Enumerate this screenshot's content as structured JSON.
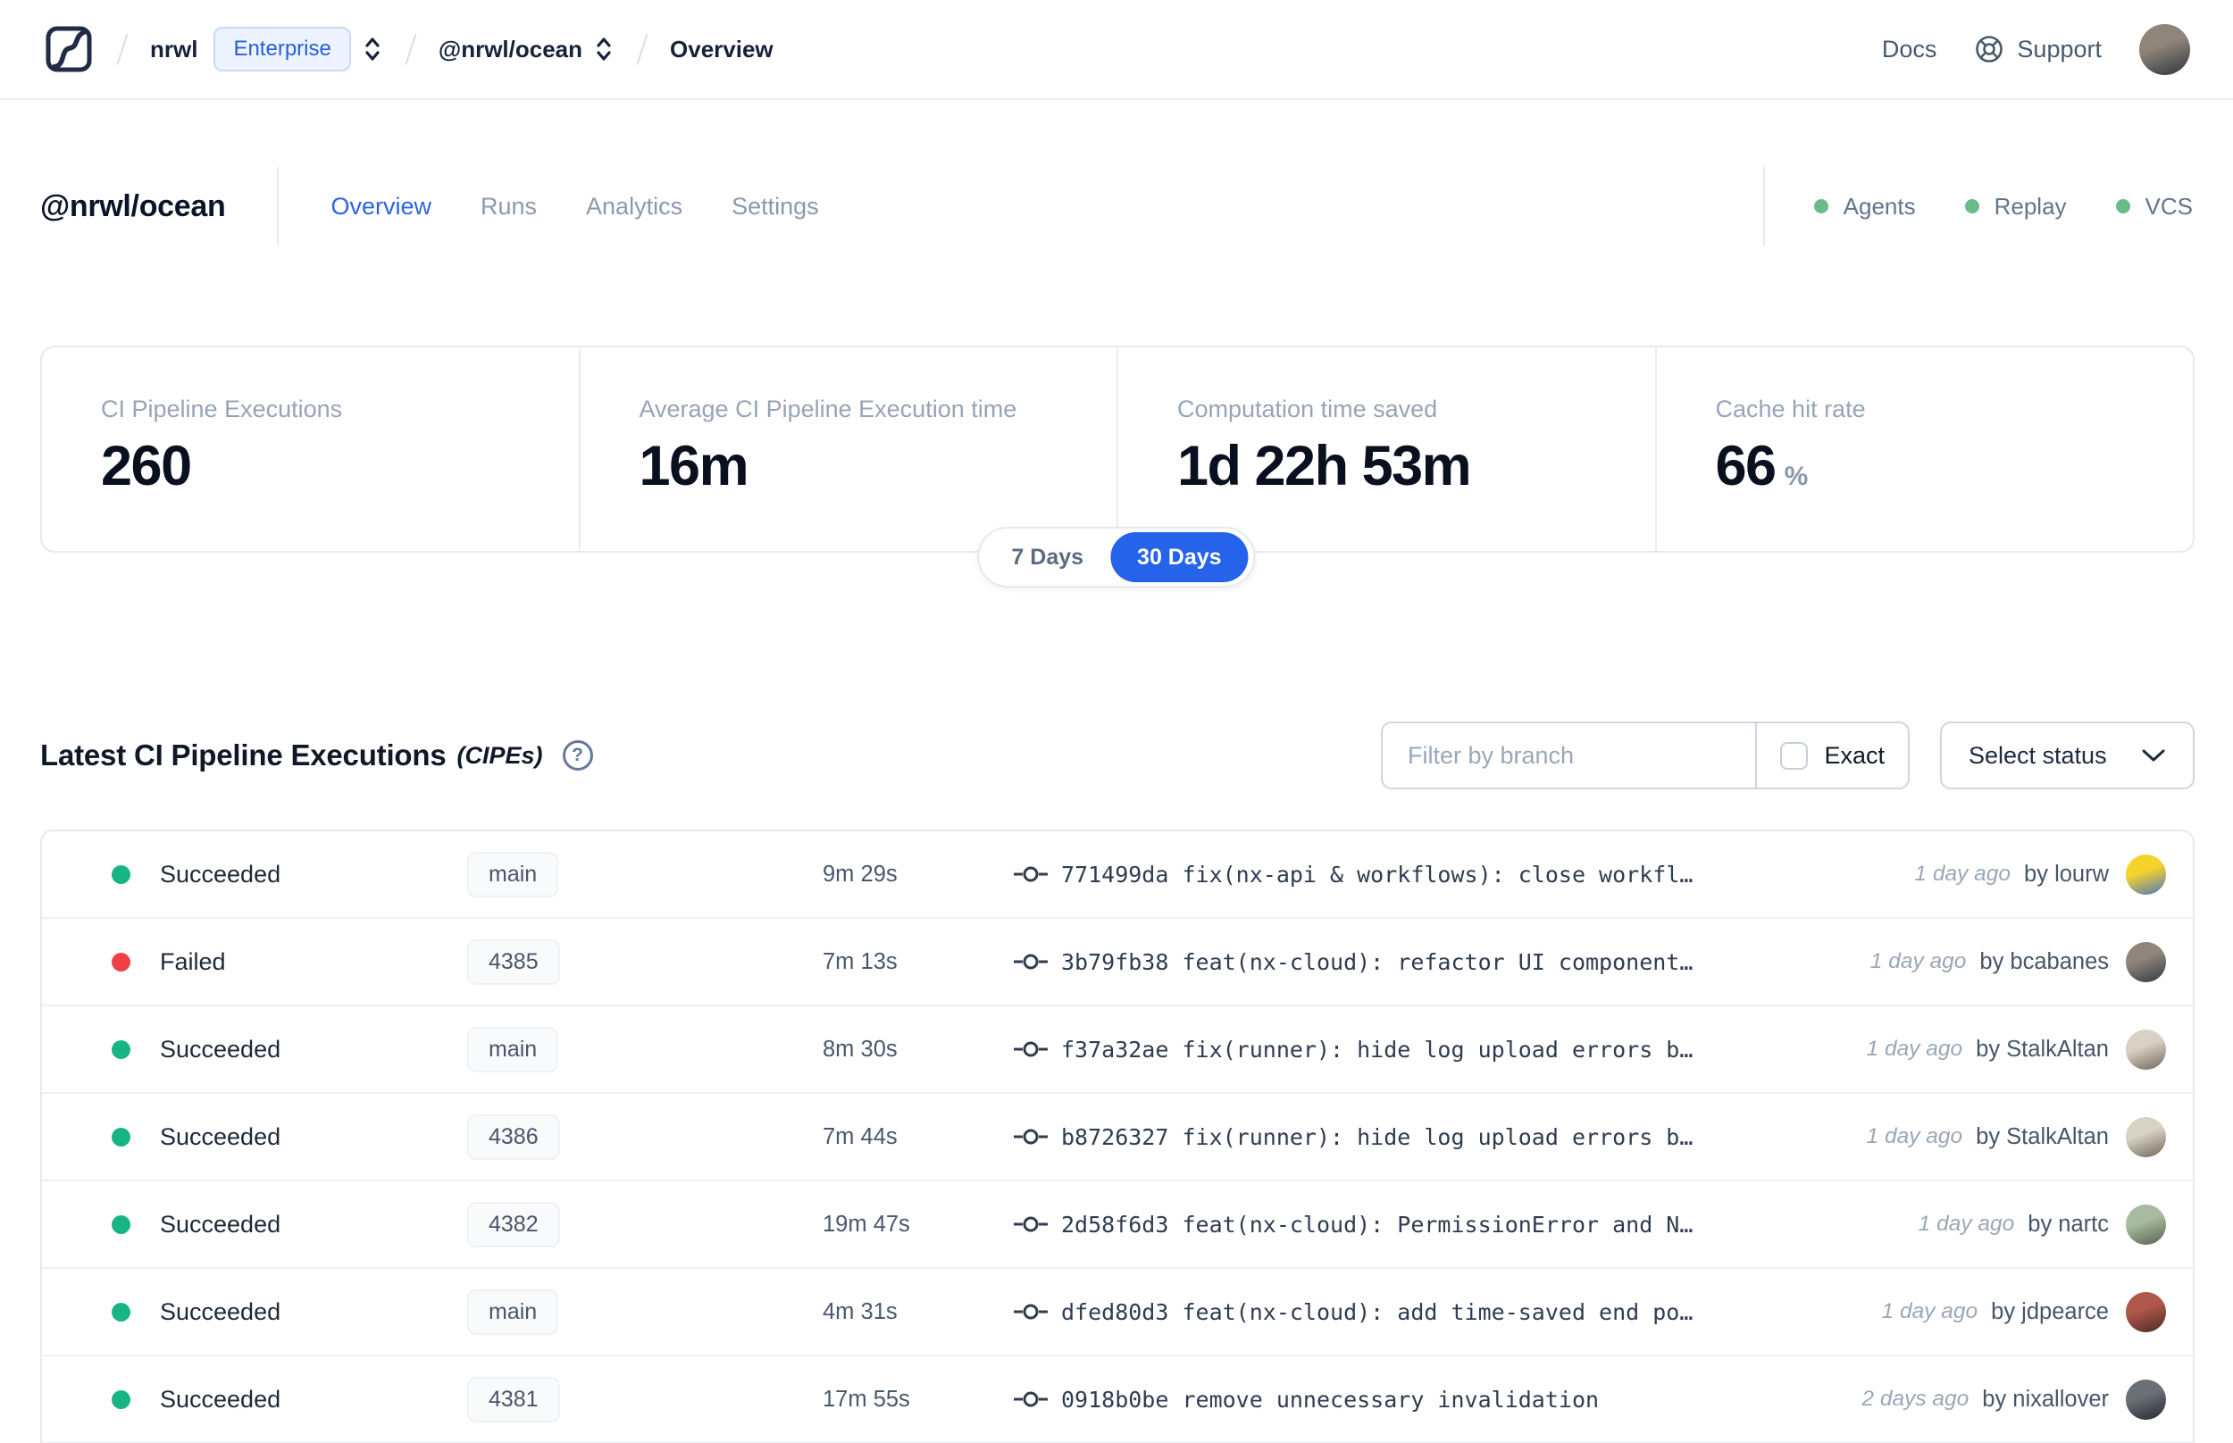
{
  "nav": {
    "breadcrumb": {
      "org": "nrwl",
      "org_badge": "Enterprise",
      "workspace": "@nrwl/ocean",
      "page": "Overview"
    },
    "links": {
      "docs": "Docs",
      "support": "Support"
    },
    "avatar_colors": [
      "#8f857a",
      "#2f353c"
    ]
  },
  "header": {
    "title": "@nrwl/ocean",
    "tabs": [
      {
        "label": "Overview",
        "active": true
      },
      {
        "label": "Runs",
        "active": false
      },
      {
        "label": "Analytics",
        "active": false
      },
      {
        "label": "Settings",
        "active": false
      }
    ],
    "statuses": [
      {
        "label": "Agents"
      },
      {
        "label": "Replay"
      },
      {
        "label": "VCS"
      }
    ],
    "status_dot_color": "#69bb87"
  },
  "stats": {
    "cards": [
      {
        "label": "CI Pipeline Executions",
        "value": "260",
        "suffix": ""
      },
      {
        "label": "Average CI Pipeline Execution time",
        "value": "16m",
        "suffix": ""
      },
      {
        "label": "Computation time saved",
        "value": "1d 22h 53m",
        "suffix": ""
      },
      {
        "label": "Cache hit rate",
        "value": "66",
        "suffix": "%"
      }
    ]
  },
  "range_toggle": {
    "options": [
      {
        "label": "7 Days",
        "active": false
      },
      {
        "label": "30 Days",
        "active": true
      }
    ],
    "active_color": "#2563eb"
  },
  "section": {
    "title": "Latest CI Pipeline Executions",
    "subtitle": "(CIPEs)",
    "help_icon": "?"
  },
  "filters": {
    "branch_placeholder": "Filter by branch",
    "branch_value": "",
    "exact_label": "Exact",
    "exact_checked": false,
    "status_button": "Select status"
  },
  "table": {
    "rows": [
      {
        "status": "Succeeded",
        "status_color": "#17b584",
        "branch": "main",
        "duration": "9m 29s",
        "commit": "771499da fix(nx-api & workflows): close workfl…",
        "time": "1 day ago",
        "author": "by lourw",
        "avatar_colors": [
          "#f6d32b",
          "#4a77c0"
        ]
      },
      {
        "status": "Failed",
        "status_color": "#ee4046",
        "branch": "4385",
        "duration": "7m 13s",
        "commit": "3b79fb38 feat(nx-cloud): refactor UI component…",
        "time": "1 day ago",
        "author": "by bcabanes",
        "avatar_colors": [
          "#8f857a",
          "#32383f"
        ]
      },
      {
        "status": "Succeeded",
        "status_color": "#17b584",
        "branch": "main",
        "duration": "8m 30s",
        "commit": "f37a32ae fix(runner): hide log upload errors b…",
        "time": "1 day ago",
        "author": "by StalkAltan",
        "avatar_colors": [
          "#d9d2c4",
          "#6f675a"
        ]
      },
      {
        "status": "Succeeded",
        "status_color": "#17b584",
        "branch": "4386",
        "duration": "7m 44s",
        "commit": "b8726327 fix(runner): hide log upload errors b…",
        "time": "1 day ago",
        "author": "by StalkAltan",
        "avatar_colors": [
          "#d9d2c4",
          "#6f675a"
        ]
      },
      {
        "status": "Succeeded",
        "status_color": "#17b584",
        "branch": "4382",
        "duration": "19m 47s",
        "commit": "2d58f6d3 feat(nx-cloud): PermissionError and N…",
        "time": "1 day ago",
        "author": "by nartc",
        "avatar_colors": [
          "#a8bba0",
          "#55624f"
        ]
      },
      {
        "status": "Succeeded",
        "status_color": "#17b584",
        "branch": "main",
        "duration": "4m 31s",
        "commit": "dfed80d3 feat(nx-cloud): add time-saved end po…",
        "time": "1 day ago",
        "author": "by jdpearce",
        "avatar_colors": [
          "#b0584a",
          "#4a2a26"
        ]
      },
      {
        "status": "Succeeded",
        "status_color": "#17b584",
        "branch": "4381",
        "duration": "17m 55s",
        "commit": "0918b0be remove unnecessary invalidation",
        "time": "2 days ago",
        "author": "by nixallover",
        "avatar_colors": [
          "#6b7076",
          "#26292d"
        ]
      }
    ]
  }
}
